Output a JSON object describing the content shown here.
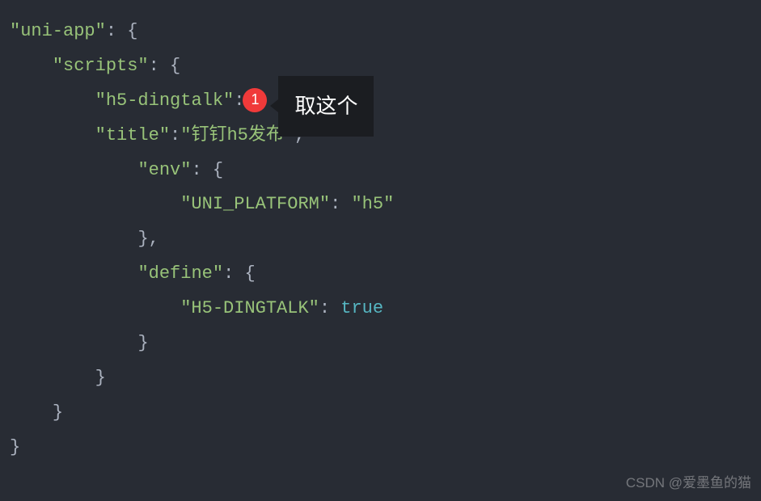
{
  "code": {
    "l1_key": "\"uni-app\"",
    "l1_after": ": {",
    "l2_key": "\"scripts\"",
    "l2_after": ": {",
    "l3_key": "\"h5-dingtalk\"",
    "l3_after": ":",
    "l4_key": "\"title\"",
    "l4_colon": ":",
    "l4_val": "\"钉钉h5发布\"",
    "l4_comma": ",",
    "l5_key": "\"env\"",
    "l5_after": ": {",
    "l6_key": "\"UNI_PLATFORM\"",
    "l6_colon": ": ",
    "l6_val": "\"h5\"",
    "l7": "},",
    "l8_key": "\"define\"",
    "l8_after": ": {",
    "l9_key": "\"H5-DINGTALK\"",
    "l9_colon": ": ",
    "l9_val": "true",
    "l10": "}",
    "l11": "}",
    "l12": "}",
    "l13": "}"
  },
  "annotation": {
    "badge_number": "1",
    "tooltip_text": "取这个"
  },
  "watermark": "CSDN @爱墨鱼的猫"
}
